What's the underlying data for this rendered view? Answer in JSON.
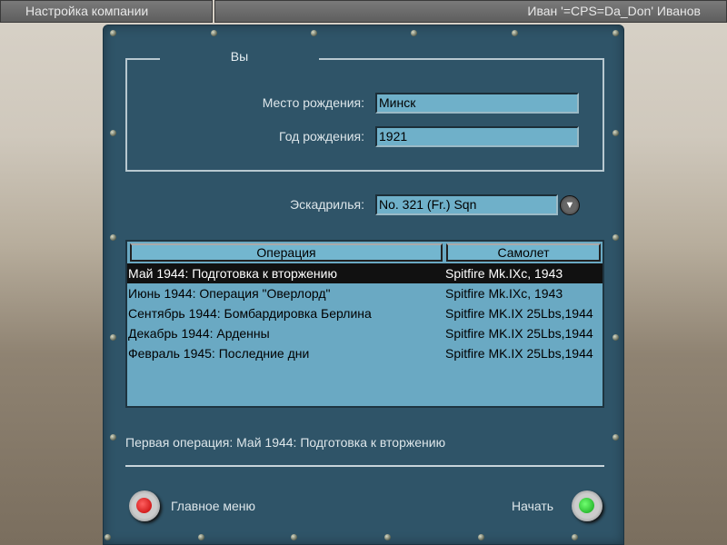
{
  "topbar": {
    "title": "Настройка компании",
    "user": "Иван '=CPS=Da_Don' Иванов"
  },
  "you": {
    "legend": "Вы",
    "birthplace_label": "Место рождения:",
    "birthplace": "Минск",
    "birthyear_label": "Год рождения:",
    "birthyear": "1921"
  },
  "squadron": {
    "label": "Эскадрилья:",
    "value": "No. 321 (Fr.) Sqn"
  },
  "table": {
    "headers": [
      "Операция",
      "Самолет"
    ],
    "rows": [
      {
        "op": "Май 1944: Подготовка к вторжению",
        "plane": "Spitfire Mk.IXc, 1943"
      },
      {
        "op": "Июнь 1944: Операция \"Оверлорд\"",
        "plane": "Spitfire Mk.IXc, 1943"
      },
      {
        "op": "Сентябрь 1944: Бомбардировка Берлина",
        "plane": "Spitfire MK.IX 25Lbs,1944"
      },
      {
        "op": "Декабрь 1944: Арденны",
        "plane": "Spitfire MK.IX 25Lbs,1944"
      },
      {
        "op": "Февраль 1945: Последние дни",
        "plane": "Spitfire MK.IX 25Lbs,1944"
      }
    ]
  },
  "status": "Первая операция: Май 1944: Подготовка к вторжению",
  "buttons": {
    "main_menu": "Главное меню",
    "start": "Начать"
  },
  "colors": {
    "panel": "#2f5468",
    "field": "#6fb0c9",
    "red": "#e01818",
    "green": "#18c020"
  }
}
